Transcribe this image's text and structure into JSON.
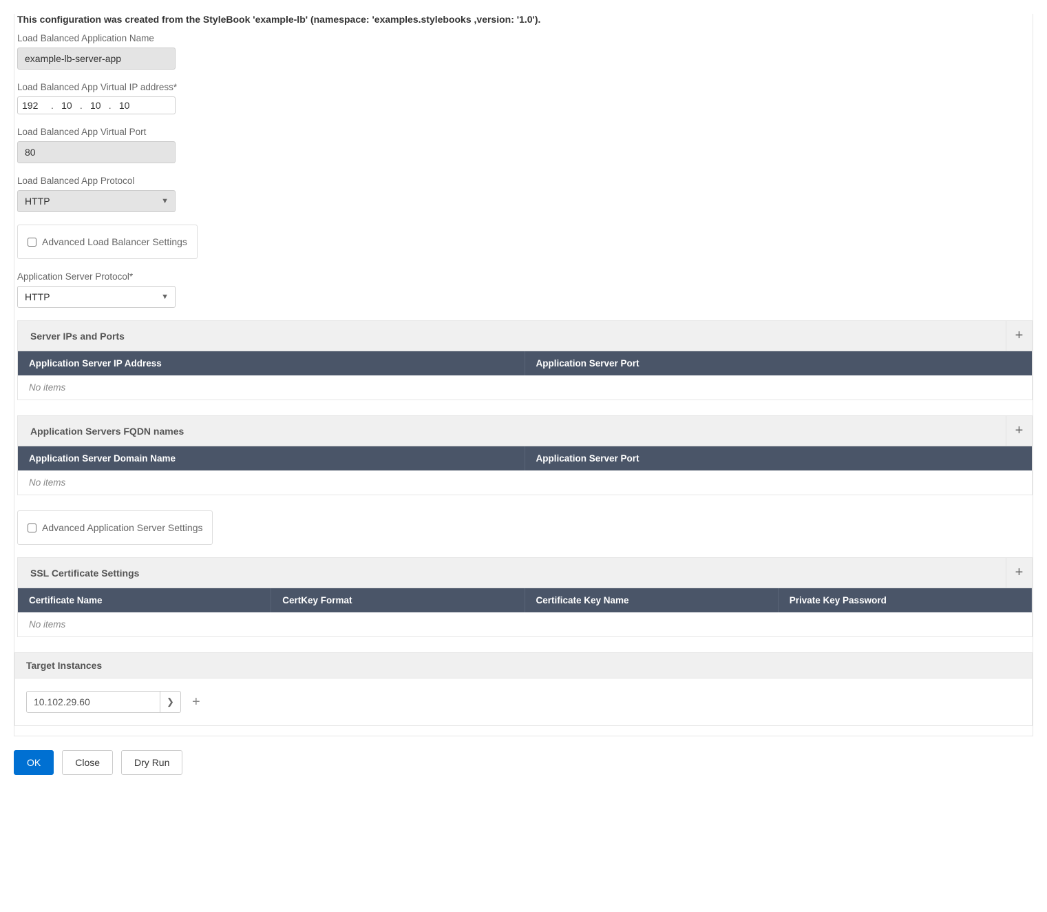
{
  "header": "This configuration was created from the StyleBook 'example-lb' (namespace: 'examples.stylebooks ,version: '1.0').",
  "fields": {
    "appName": {
      "label": "Load Balanced Application Name",
      "value": "example-lb-server-app"
    },
    "vip": {
      "label": "Load Balanced App Virtual IP address*",
      "octets": [
        "192",
        "10",
        "10",
        "10"
      ]
    },
    "vport": {
      "label": "Load Balanced App Virtual Port",
      "value": "80"
    },
    "protocol": {
      "label": "Load Balanced App Protocol",
      "value": "HTTP"
    },
    "advancedLB": {
      "label": "Advanced Load Balancer Settings"
    },
    "appServerProtocol": {
      "label": "Application Server Protocol*",
      "value": "HTTP"
    },
    "advancedAppServer": {
      "label": "Advanced Application Server Settings"
    }
  },
  "sections": {
    "serverIps": {
      "title": "Server IPs and Ports",
      "cols": [
        "Application Server IP Address",
        "Application Server Port"
      ],
      "empty": "No items"
    },
    "fqdn": {
      "title": "Application Servers FQDN names",
      "cols": [
        "Application Server Domain Name",
        "Application Server Port"
      ],
      "empty": "No items"
    },
    "ssl": {
      "title": "SSL Certificate Settings",
      "cols": [
        "Certificate Name",
        "CertKey Format",
        "Certificate Key Name",
        "Private Key Password"
      ],
      "empty": "No items"
    }
  },
  "target": {
    "title": "Target Instances",
    "value": "10.102.29.60"
  },
  "buttons": {
    "ok": "OK",
    "close": "Close",
    "dryRun": "Dry Run"
  }
}
